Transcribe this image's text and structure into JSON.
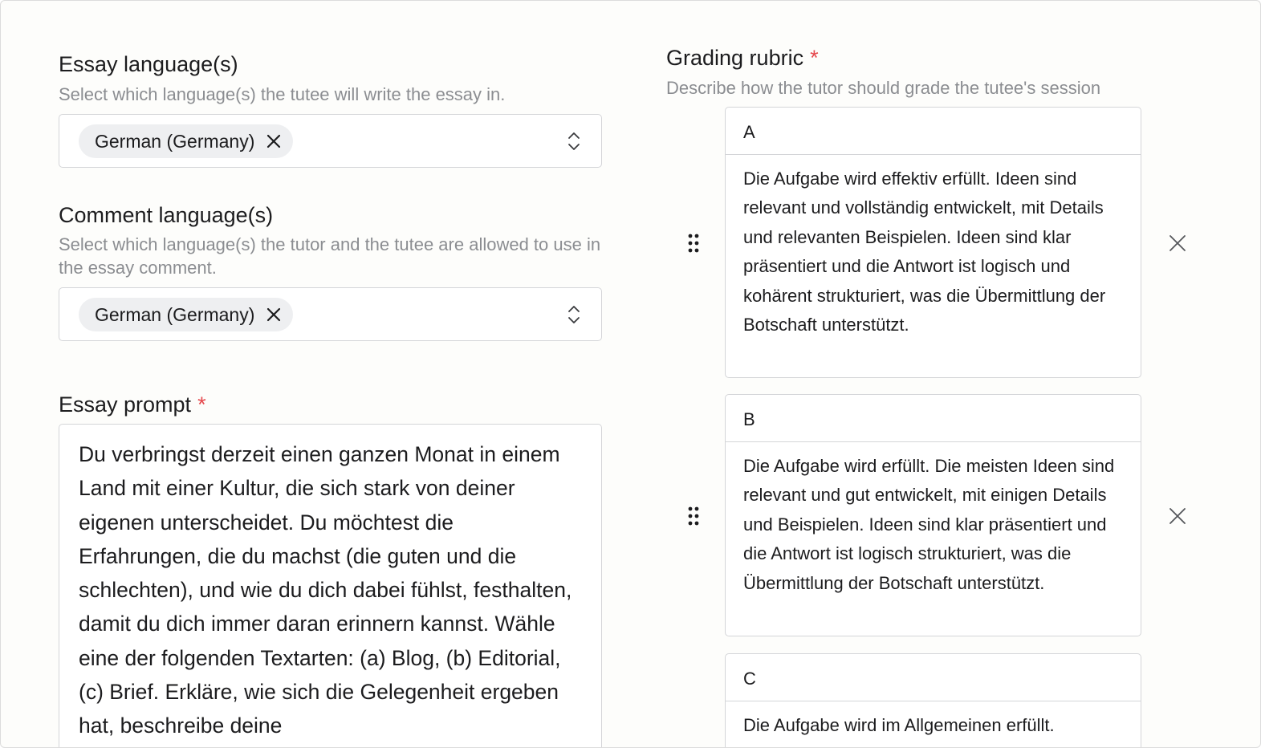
{
  "essay_language": {
    "title": "Essay language(s)",
    "help": "Select which language(s) the tutee will write the essay in.",
    "selected": [
      "German (Germany)"
    ]
  },
  "comment_language": {
    "title": "Comment language(s)",
    "help": "Select which language(s) the tutor and the tutee are allowed to use in the essay comment.",
    "selected": [
      "German (Germany)"
    ]
  },
  "essay_prompt": {
    "title": "Essay prompt",
    "required_marker": "*",
    "value": "Du verbringst derzeit einen ganzen Monat in einem Land mit einer Kultur, die sich stark von deiner eigenen unterscheidet. Du möchtest die Erfahrungen, die du machst (die guten und die schlechten), und wie du dich dabei fühlst, festhalten, damit du dich immer daran erinnern kannst. Wähle eine der folgenden Textarten: (a) Blog, (b) Editorial, (c) Brief. Erkläre, wie sich die Gelegenheit ergeben hat, beschreibe deine"
  },
  "grading_rubric": {
    "title": "Grading rubric",
    "required_marker": "*",
    "help": "Describe how the tutor should grade the tutee's session",
    "items": [
      {
        "grade": "A",
        "description": "Die Aufgabe wird effektiv erfüllt. Ideen sind relevant und vollständig entwickelt, mit Details und relevanten Beispielen. Ideen sind klar präsentiert und die Antwort ist logisch und kohärent strukturiert, was die Übermittlung der Botschaft unterstützt."
      },
      {
        "grade": "B",
        "description": "Die Aufgabe wird erfüllt. Die meisten Ideen sind relevant und gut entwickelt, mit einigen Details und Beispielen. Ideen sind klar präsentiert und die Antwort ist logisch strukturiert, was die Übermittlung der Botschaft unterstützt."
      },
      {
        "grade": "C",
        "description": "Die Aufgabe wird im Allgemeinen erfüllt."
      }
    ]
  },
  "icons": {
    "chip_remove": "close-icon",
    "select_toggle": "chevron-up-down-icon",
    "drag": "drag-handle-icon",
    "rubric_remove": "close-icon"
  },
  "colors": {
    "required": "#e5484d",
    "help_text": "#8b8d91",
    "border": "#d4d5d8",
    "chip_bg": "#eeeff1"
  }
}
